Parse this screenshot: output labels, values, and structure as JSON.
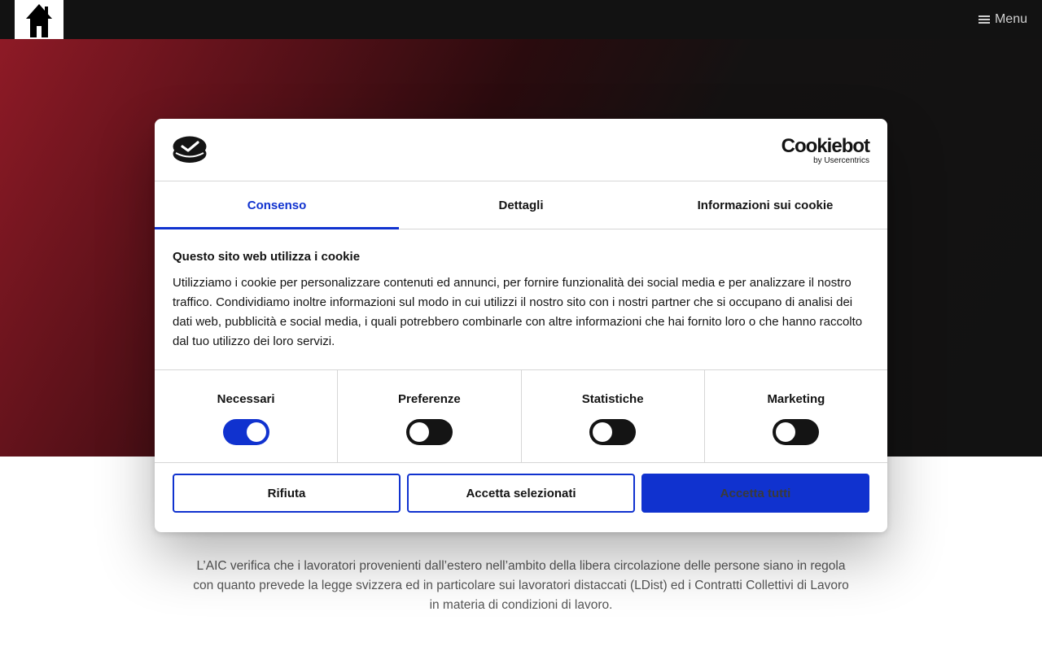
{
  "site": {
    "menu_label": "Menu",
    "body_text": "L’AIC verifica che i lavoratori provenienti dall’estero nell’ambito della libera circolazione delle persone siano in regola con quanto prevede la legge svizzera ed in particolare sui lavoratori distaccati (LDist) ed i Contratti Collettivi di Lavoro in materia di condizioni di lavoro."
  },
  "dialog": {
    "brand": {
      "name": "Cookiebot",
      "sub": "by Usercentrics"
    },
    "tabs": [
      {
        "label": "Consenso",
        "active": true
      },
      {
        "label": "Dettagli",
        "active": false
      },
      {
        "label": "Informazioni sui cookie",
        "active": false
      }
    ],
    "heading": "Questo sito web utilizza i cookie",
    "description": "Utilizziamo i cookie per personalizzare contenuti ed annunci, per fornire funzionalità dei social media e per analizzare il nostro traffico. Condividiamo inoltre informazioni sul modo in cui utilizzi il nostro sito con i nostri partner che si occupano di analisi dei dati web, pubblicità e social media, i quali potrebbero combinarle con altre informazioni che hai fornito loro o che hanno raccolto dal tuo utilizzo dei loro servizi.",
    "toggles": [
      {
        "label": "Necessari",
        "on": true
      },
      {
        "label": "Preferenze",
        "on": false
      },
      {
        "label": "Statistiche",
        "on": false
      },
      {
        "label": "Marketing",
        "on": false
      }
    ],
    "buttons": {
      "reject": "Rifiuta",
      "accept_selected": "Accetta selezionati",
      "accept_all": "Accetta tutti"
    }
  },
  "colors": {
    "accent": "#1032cf",
    "topbar": "#121212",
    "hero_red": "#8e1a26"
  },
  "icons": [
    "home-icon",
    "hamburger-icon",
    "cookiebot-logo-icon"
  ]
}
